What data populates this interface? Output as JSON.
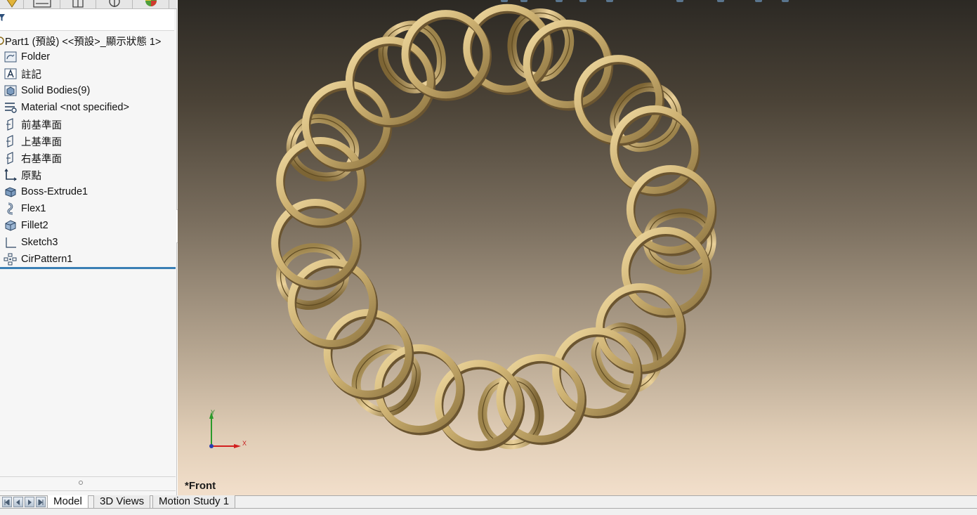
{
  "feature_manager": {
    "root": {
      "label": "Part1 (預設) <<預設>_顯示狀態 1>"
    },
    "items": [
      {
        "label": "Folder",
        "icon": "folder-icon"
      },
      {
        "label": "註記",
        "icon": "annotation-icon"
      },
      {
        "label": "Solid Bodies(9)",
        "icon": "solid-bodies-icon"
      },
      {
        "label": "Material <not specified>",
        "icon": "material-icon"
      },
      {
        "label": "前基準面",
        "icon": "plane-icon"
      },
      {
        "label": "上基準面",
        "icon": "plane-icon"
      },
      {
        "label": "右基準面",
        "icon": "plane-icon"
      },
      {
        "label": "原點",
        "icon": "origin-icon"
      },
      {
        "label": "Boss-Extrude1",
        "icon": "extrude-icon"
      },
      {
        "label": "Flex1",
        "icon": "flex-icon"
      },
      {
        "label": "Fillet2",
        "icon": "fillet-icon"
      },
      {
        "label": "Sketch3",
        "icon": "sketch-icon"
      },
      {
        "label": "CirPattern1",
        "icon": "circular-pattern-icon"
      }
    ]
  },
  "viewport": {
    "view_name": "*Front",
    "triad": {
      "x": "X",
      "y": "Y"
    }
  },
  "bottom_tabs": [
    {
      "label": "Model",
      "active": true
    },
    {
      "label": "3D Views",
      "active": false
    },
    {
      "label": "Motion Study 1",
      "active": false
    }
  ],
  "colors": {
    "gold": "#c9ad6e",
    "rollback_bar": "#3a7fb5"
  }
}
